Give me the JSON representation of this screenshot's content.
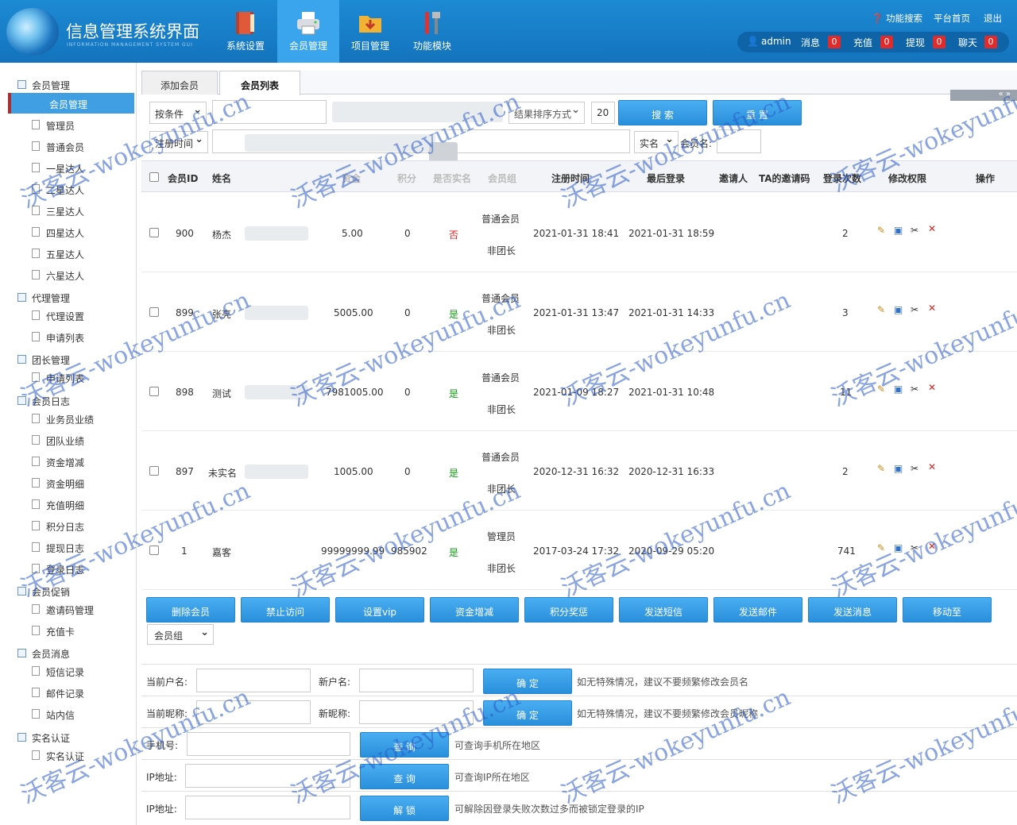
{
  "header": {
    "title": "信息管理系统界面",
    "subtitle": "INFORMATION MANAGEMENT SYSTEM GUI",
    "nav": [
      {
        "label": "系统设置",
        "icon": "book-icon"
      },
      {
        "label": "会员管理",
        "icon": "printer-icon"
      },
      {
        "label": "项目管理",
        "icon": "folder-icon"
      },
      {
        "label": "功能模块",
        "icon": "tools-icon"
      }
    ],
    "toplinks": {
      "help": "功能搜索",
      "home": "平台首页",
      "logout": "退出"
    },
    "user": {
      "name": "admin",
      "msg": "消息",
      "msg_n": "0",
      "recharge": "充值",
      "recharge_n": "0",
      "withdraw": "提现",
      "withdraw_n": "0",
      "chat": "聊天",
      "chat_n": "0"
    }
  },
  "sidebar": {
    "g1": "会员管理",
    "active": "会员管理",
    "g1_items": [
      "管理员",
      "普通会员",
      "一星达人",
      "二星达人",
      "三星达人",
      "四星达人",
      "五星达人",
      "六星达人"
    ],
    "g2": "代理管理",
    "g2_items": [
      "代理设置",
      "申请列表"
    ],
    "g3": "团长管理",
    "g3_items": [
      "申请列表"
    ],
    "g4": "会员日志",
    "g4_items": [
      "业务员业绩",
      "团队业绩",
      "资金增减",
      "资金明细",
      "充值明细",
      "积分日志",
      "提现日志",
      "登录日志"
    ],
    "g5": "会员促销",
    "g5_items": [
      "邀请码管理",
      "充值卡"
    ],
    "g6": "会员消息",
    "g6_items": [
      "短信记录",
      "邮件记录",
      "站内信"
    ],
    "g7": "实名认证",
    "g7_items": [
      "实名认证"
    ]
  },
  "tabs": {
    "add": "添加会员",
    "list": "会员列表",
    "pager": "« »"
  },
  "filters": {
    "cond": "按条件",
    "sort": "结果排序方式",
    "count": "20",
    "search": "搜 索",
    "reset": "重 置",
    "regtime": "注册时间",
    "realname": "实名",
    "username_label": "会员名:"
  },
  "table": {
    "headers": {
      "id": "会员ID",
      "name": "姓名",
      "money": "资金",
      "score": "积分",
      "real": "是否实名",
      "group": "会员组",
      "reg": "注册时间",
      "last": "最后登录",
      "inviter": "邀请人",
      "code": "TA的邀请码",
      "logins": "登录次数",
      "perm": "修改权限",
      "op": "操作"
    },
    "rows": [
      {
        "id": "900",
        "name": "杨杰",
        "money": "5.00",
        "score": "0",
        "real": "否",
        "group": "普通会员",
        "team": "非团长",
        "reg": "2021-01-31 18:41",
        "last": "2021-01-31 18:59",
        "logins": "2"
      },
      {
        "id": "899",
        "name": "张亮",
        "money": "5005.00",
        "score": "0",
        "real": "是",
        "group": "普通会员",
        "team": "非团长",
        "reg": "2021-01-31 13:47",
        "last": "2021-01-31 14:33",
        "logins": "3"
      },
      {
        "id": "898",
        "name": "测试",
        "money": "7981005.00",
        "score": "0",
        "real": "是",
        "group": "普通会员",
        "team": "非团长",
        "reg": "2021-01-09 18:27",
        "last": "2021-01-31 10:48",
        "logins": "11"
      },
      {
        "id": "897",
        "name": "未实名",
        "money": "1005.00",
        "score": "0",
        "real": "是",
        "group": "普通会员",
        "team": "非团长",
        "reg": "2020-12-31 16:32",
        "last": "2020-12-31 16:33",
        "logins": "2"
      },
      {
        "id": "1",
        "name": "嘉客",
        "money": "99999999.99",
        "score": "985902",
        "real": "是",
        "group": "管理员",
        "team": "非团长",
        "reg": "2017-03-24 17:32",
        "last": "2020-09-29 05:20",
        "logins": "741"
      }
    ]
  },
  "actions": [
    "删除会员",
    "禁止访问",
    "设置vip",
    "资金增减",
    "积分奖惩",
    "发送短信",
    "发送邮件",
    "发送消息",
    "移动至"
  ],
  "move_group": "会员组",
  "forms": {
    "cur_user": "当前户名:",
    "new_user": "新户名:",
    "confirm": "确 定",
    "tip_user": "如无特殊情况，建议不要频繁修改会员名",
    "cur_nick": "当前昵称:",
    "new_nick": "新昵称:",
    "tip_nick": "如无特殊情况，建议不要频繁修改会员昵称",
    "phone": "手机号:",
    "query": "查 询",
    "tip_phone": "可查询手机所在地区",
    "ip": "IP地址:",
    "tip_ip": "可查询IP所在地区",
    "ip2": "IP地址:",
    "unlock": "解 锁",
    "tip_unlock": "可解除因登录失败次数过多而被锁定登录的IP"
  },
  "watermark": "沃客云-wokeyunfu.cn"
}
